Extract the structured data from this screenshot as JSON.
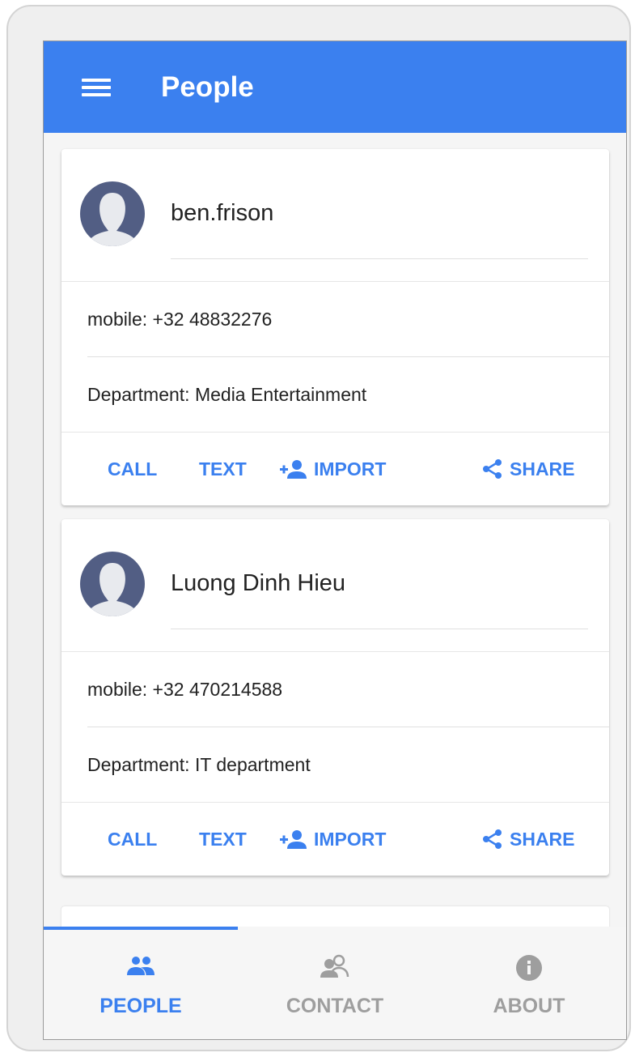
{
  "app": {
    "title": "People"
  },
  "colors": {
    "accent": "#3b80ef",
    "avatar": "#525e84",
    "inactive": "#9e9e9e"
  },
  "people": [
    {
      "name": "ben.frison",
      "mobile": "mobile: +32 48832276",
      "department": "Department: Media Entertainment"
    },
    {
      "name": "Luong Dinh Hieu",
      "mobile": "mobile: +32 470214588",
      "department": "Department: IT department"
    }
  ],
  "actions": {
    "call": "CALL",
    "text": "TEXT",
    "import": "IMPORT",
    "share": "SHARE"
  },
  "nav": {
    "people": {
      "label": "PEOPLE",
      "icon": "people-icon",
      "active": true
    },
    "contact": {
      "label": "CONTACT",
      "icon": "contact-icon",
      "active": false
    },
    "about": {
      "label": "ABOUT",
      "icon": "info-icon",
      "active": false
    }
  }
}
